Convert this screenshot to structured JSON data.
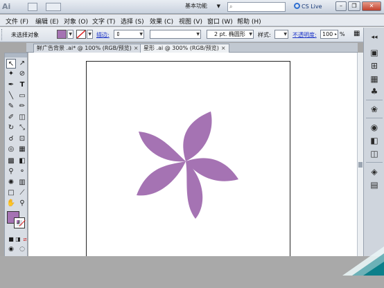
{
  "app": {
    "logo_text": "Ai",
    "workspace": "基本功能",
    "search_placeholder": "",
    "cs_live": "CS Live"
  },
  "menu": {
    "items": [
      "文件 (F)",
      "编辑 (E)",
      "对象 (O)",
      "文字 (T)",
      "选择 (S)",
      "效果 (C)",
      "视图 (V)",
      "窗口 (W)",
      "帮助 (H)"
    ]
  },
  "control_bar": {
    "selection_label": "未选择对象",
    "stroke_link": "描边:",
    "brush_value": "2 pt. 椭圆形",
    "style_label": "样式:",
    "opacity_link": "不透明度:",
    "opacity_value": "100",
    "percent": "%",
    "fill_color": "#a573b3"
  },
  "tabs": [
    {
      "label": "鲜广告背景 .ai* @ 100% (RGB/预览)",
      "close": "×"
    },
    {
      "label": "星形 .ai @ 300% (RGB/预览)",
      "close": "×"
    }
  ],
  "artwork": {
    "shape": "five-petal-flower",
    "color": "#a573b3"
  },
  "colors": {
    "accent": "#a573b3",
    "teal": "#0b7f8a"
  }
}
